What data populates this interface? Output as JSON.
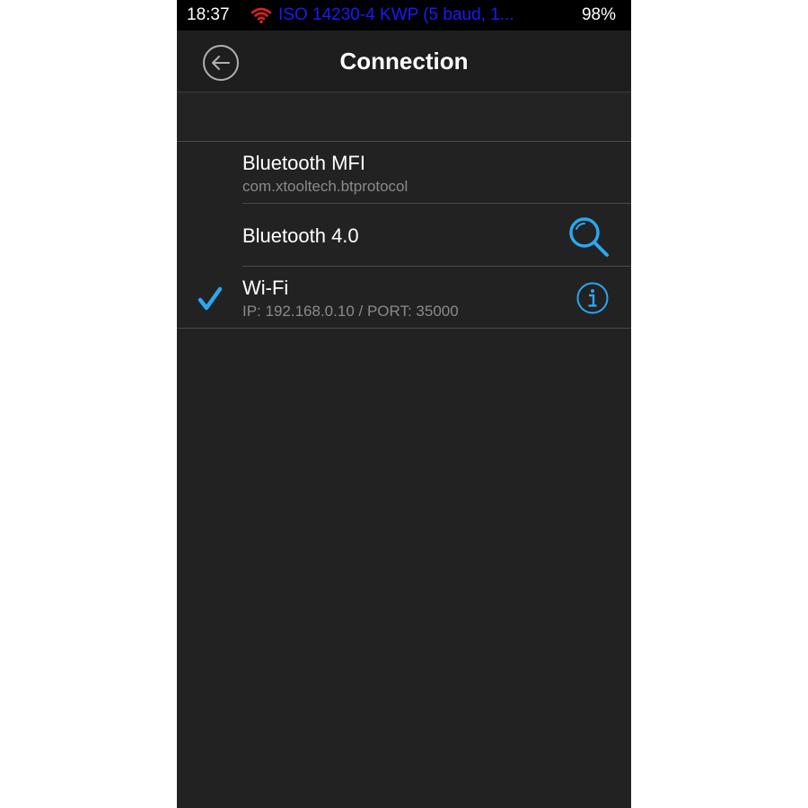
{
  "status_bar": {
    "time": "18:37",
    "wifi_icon": "wifi-icon",
    "wifi_color": "#e02020",
    "protocol": "ISO 14230-4 KWP (5 baud, 1...",
    "protocol_color": "#1a1aff",
    "battery": "98%"
  },
  "nav": {
    "back_icon": "back-arrow-icon",
    "title": "Connection"
  },
  "accent_color": "#2aa8f2",
  "connections": [
    {
      "title": "Bluetooth MFI",
      "subtitle": "com.xtooltech.btprotocol",
      "selected": false
    },
    {
      "title": "Bluetooth 4.0",
      "action_icon": "search-icon",
      "selected": false
    },
    {
      "title": "Wi-Fi",
      "subtitle": "IP: 192.168.0.10 / PORT: 35000",
      "action_icon": "info-icon",
      "selected": true,
      "selected_icon": "checkmark-icon"
    }
  ]
}
